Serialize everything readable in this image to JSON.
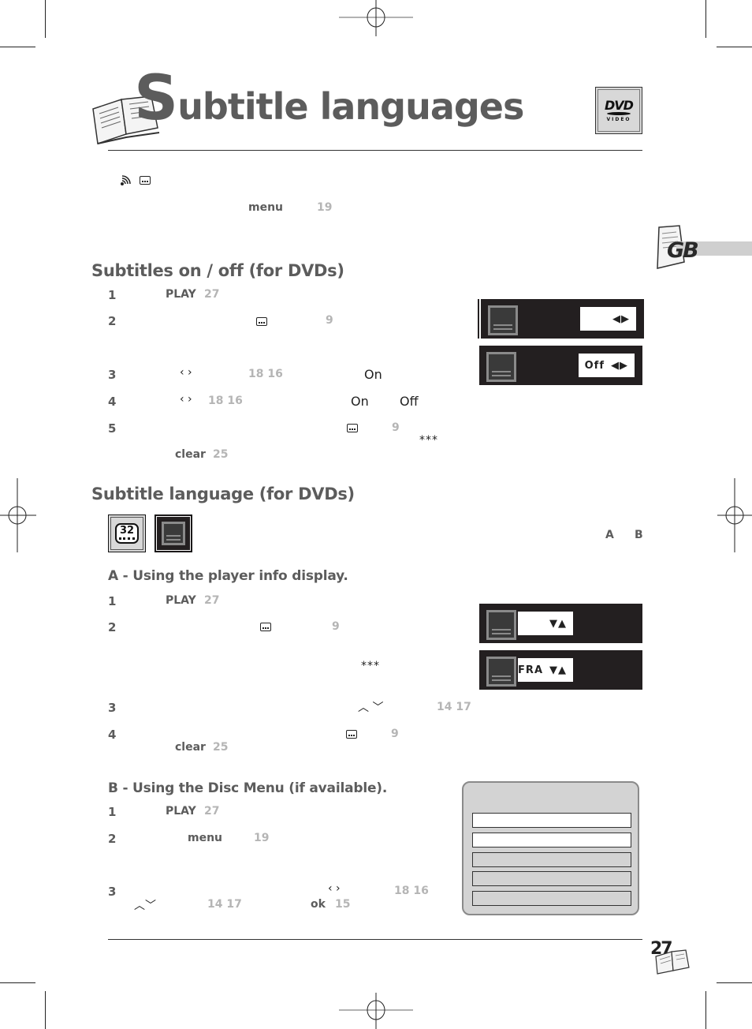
{
  "page": {
    "title_initial": "S",
    "title_rest": "ubtitle languages",
    "page_number": "27",
    "language_tab": "GB",
    "dvd_logo": {
      "line1": "DVD",
      "line2": "VIDEO"
    }
  },
  "intro": {
    "icons": [
      "audio-icon",
      "subtitle-icon"
    ],
    "keyword": "menu",
    "ref": "19"
  },
  "section1": {
    "heading": "Subtitles on / off (for DVDs)",
    "steps": [
      {
        "num": "1",
        "keyword": "PLAY",
        "ref": "27"
      },
      {
        "num": "2",
        "ref": "9"
      },
      {
        "num": "3",
        "glyph": "‹ ›",
        "refs": "18  16",
        "value": "On"
      },
      {
        "num": "4",
        "glyph": "‹ ›",
        "refs": "18  16",
        "value1": "On",
        "value2": "Off"
      },
      {
        "num": "5",
        "ref": "9",
        "stars": "***",
        "keyword": "clear",
        "ref2": "25"
      }
    ],
    "osd": [
      {
        "value": "",
        "arrows": "◀▶"
      },
      {
        "value": "Off",
        "arrows": "◀▶"
      }
    ]
  },
  "section2": {
    "heading": "Subtitle language (for DVDs)",
    "badge_number": "32",
    "options_label_a": "A",
    "options_label_b": "B",
    "partA": {
      "heading": "A - Using the player info display.",
      "steps": [
        {
          "num": "1",
          "keyword": "PLAY",
          "ref": "27"
        },
        {
          "num": "2",
          "ref": "9",
          "stars": "***"
        },
        {
          "num": "3",
          "glyph": "︿ ﹀",
          "refs": "14  17"
        },
        {
          "num": "4",
          "ref": "9",
          "keyword": "clear",
          "ref2": "25"
        }
      ],
      "osd": [
        {
          "value": "",
          "arrows": "▼▲"
        },
        {
          "value": "FRA",
          "arrows": "▼▲"
        }
      ]
    },
    "partB": {
      "heading": "B - Using the Disc Menu (if available).",
      "steps": [
        {
          "num": "1",
          "keyword": "PLAY",
          "ref": "27"
        },
        {
          "num": "2",
          "keyword": "menu",
          "ref": "19"
        },
        {
          "num": "3",
          "glyph": "‹ ›",
          "refs": "18  16",
          "glyph2": "︿﹀",
          "refs2": "14  17",
          "keyword": "ok",
          "ref": "15"
        }
      ],
      "menu_rows": [
        {
          "highlighted": true
        },
        {
          "highlighted": true
        },
        {
          "highlighted": false
        },
        {
          "highlighted": false
        },
        {
          "highlighted": false
        }
      ]
    }
  }
}
